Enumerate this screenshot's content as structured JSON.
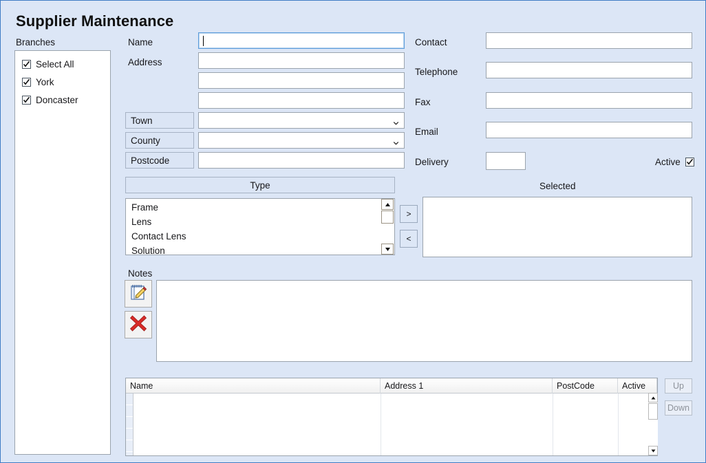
{
  "window": {
    "title": "Supplier Maintenance",
    "background_color": "#dce6f6",
    "border_color": "#3f7bc4"
  },
  "branches": {
    "label": "Branches",
    "items": [
      {
        "label": "Select All",
        "checked": true
      },
      {
        "label": "York",
        "checked": true
      },
      {
        "label": "Doncaster",
        "checked": true
      }
    ]
  },
  "form": {
    "name": {
      "label": "Name",
      "value": "",
      "focused": true
    },
    "address": {
      "label": "Address",
      "lines": [
        "",
        "",
        ""
      ]
    },
    "town": {
      "label": "Town",
      "value": ""
    },
    "county": {
      "label": "County",
      "value": ""
    },
    "postcode": {
      "label": "Postcode",
      "value": ""
    },
    "contact": {
      "label": "Contact",
      "value": ""
    },
    "telephone": {
      "label": "Telephone",
      "value": ""
    },
    "fax": {
      "label": "Fax",
      "value": ""
    },
    "email": {
      "label": "Email",
      "value": ""
    },
    "delivery": {
      "label": "Delivery",
      "value": ""
    },
    "active": {
      "label": "Active",
      "checked": true
    }
  },
  "type_section": {
    "header": "Type",
    "available": [
      "Frame",
      "Lens",
      "Contact Lens",
      "Solution"
    ],
    "selected_header": "Selected",
    "selected": [],
    "add_button": ">",
    "remove_button": "<"
  },
  "notes": {
    "label": "Notes",
    "value": "",
    "edit_icon": "notepad-pencil-icon",
    "delete_icon": "red-x-icon"
  },
  "grid": {
    "columns": [
      "Name",
      "Address 1",
      "PostCode",
      "Active"
    ],
    "rows": [],
    "up_button": "Up",
    "down_button": "Down"
  }
}
